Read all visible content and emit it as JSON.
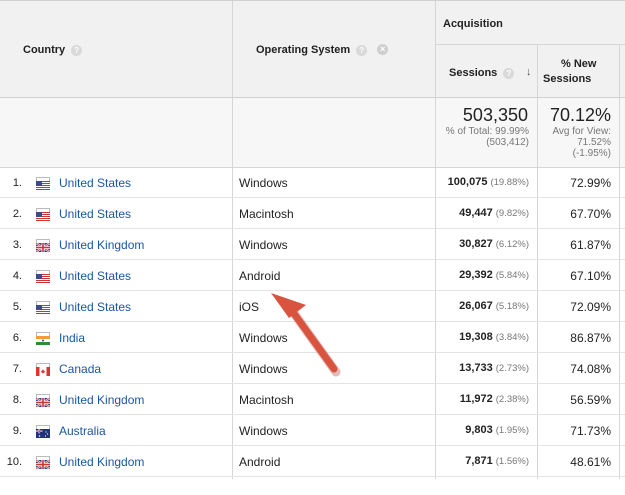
{
  "header": {
    "country": "Country",
    "operating_system": "Operating System",
    "group": "Acquisition",
    "sessions": "Sessions",
    "new_sessions_line1": "% New",
    "new_sessions_line2": "Sessions",
    "help_glyph": "?",
    "remove_glyph": "×",
    "sort_glyph": "↓"
  },
  "totals": {
    "sessions": "503,350",
    "sessions_sub1": "% of Total: 99.99%",
    "sessions_sub2": "(503,412)",
    "new_sessions": "70.12%",
    "new_sessions_sub1": "Avg for View:",
    "new_sessions_sub2": "71.52%",
    "new_sessions_sub3": "(-1.95%)"
  },
  "rows": [
    {
      "num": "1.",
      "country": "United States",
      "flag": "us-flag-icon",
      "os": "Windows",
      "sessions": "100,075",
      "pct": "(19.88%)",
      "new": "72.99%"
    },
    {
      "num": "2.",
      "country": "United States",
      "flag": "us-flag-icon",
      "os": "Macintosh",
      "sessions": "49,447",
      "pct": "(9.82%)",
      "new": "67.70%"
    },
    {
      "num": "3.",
      "country": "United Kingdom",
      "flag": "uk-flag-icon",
      "os": "Windows",
      "sessions": "30,827",
      "pct": "(6.12%)",
      "new": "61.87%"
    },
    {
      "num": "4.",
      "country": "United States",
      "flag": "us-flag-icon",
      "os": "Android",
      "sessions": "29,392",
      "pct": "(5.84%)",
      "new": "67.10%"
    },
    {
      "num": "5.",
      "country": "United States",
      "flag": "us-flag-icon",
      "os": "iOS",
      "sessions": "26,067",
      "pct": "(5.18%)",
      "new": "72.09%"
    },
    {
      "num": "6.",
      "country": "India",
      "flag": "india-flag-icon",
      "os": "Windows",
      "sessions": "19,308",
      "pct": "(3.84%)",
      "new": "86.87%"
    },
    {
      "num": "7.",
      "country": "Canada",
      "flag": "canada-flag-icon",
      "os": "Windows",
      "sessions": "13,733",
      "pct": "(2.73%)",
      "new": "74.08%"
    },
    {
      "num": "8.",
      "country": "United Kingdom",
      "flag": "uk-flag-icon",
      "os": "Macintosh",
      "sessions": "11,972",
      "pct": "(2.38%)",
      "new": "56.59%"
    },
    {
      "num": "9.",
      "country": "Australia",
      "flag": "australia-flag-icon",
      "os": "Windows",
      "sessions": "9,803",
      "pct": "(1.95%)",
      "new": "71.73%"
    },
    {
      "num": "10.",
      "country": "United Kingdom",
      "flag": "uk-flag-icon",
      "os": "Android",
      "sessions": "7,871",
      "pct": "(1.56%)",
      "new": "48.61%"
    }
  ],
  "colors": {
    "link": "#1a56a5",
    "annotation_arrow": "#d9543f"
  },
  "annotation": {
    "arrow_icon": "red-arrow-icon"
  }
}
